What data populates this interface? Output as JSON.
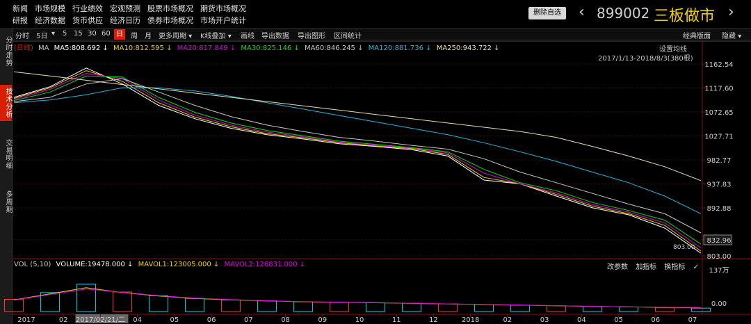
{
  "menu": {
    "row1": [
      "新闻",
      "市场规模",
      "行业绩效",
      "宏观预测",
      "股票市场概况",
      "期货市场概况"
    ],
    "row2": [
      "研报",
      "经济数据",
      "货币供应",
      "经济日历",
      "债券市场概况",
      "市场开户统计"
    ]
  },
  "header": {
    "remove_fav": "删除自选",
    "code": "899002",
    "name": "三板做市",
    "name_color": "#f0d000"
  },
  "toolbar": {
    "items": [
      "分时",
      "5日",
      "▾",
      "5",
      "15",
      "30",
      "60",
      "日",
      "周",
      "月",
      "更多周期 ▾",
      "K线叠加 ▾",
      "画线",
      "导出数据",
      "导出图形",
      "区间统计"
    ],
    "active": "日",
    "right": [
      "经典版面",
      "隐藏 ▾"
    ]
  },
  "side_tabs": [
    "分时走势",
    "技术分析",
    "交易明细",
    "多周期"
  ],
  "ma_legend": {
    "prefix": "(日线)",
    "items": [
      {
        "label": "MA",
        "color": "#c8c8c8"
      },
      {
        "label": "MA5:808.692 ↓",
        "color": "#ffffff"
      },
      {
        "label": "MA10:812.595 ↓",
        "color": "#f0d000"
      },
      {
        "label": "MA20:817.849 ↓",
        "color": "#e000e0"
      },
      {
        "label": "MA30:825.146 ↓",
        "color": "#00e000"
      },
      {
        "label": "MA60:846.245 ↓",
        "color": "#c8c8c8"
      },
      {
        "label": "MA120:881.736 ↓",
        "color": "#1fb6e0"
      },
      {
        "label": "MA250:943.722 ↓",
        "color": "#e8e0a8"
      }
    ],
    "settings": "设置均线",
    "date_range": "2017/1/13-2018/8/3(380根)"
  },
  "price_axis": {
    "ticks": [
      "1162.54",
      "1117.60",
      "1072.65",
      "1027.71",
      "982.77",
      "937.83",
      "892.88",
      "832.96",
      "803.00"
    ],
    "current": "832.96",
    "low_label": "803.00",
    "high_label": "1162.54"
  },
  "vol_legend": {
    "items": [
      {
        "label": "VOL (5,10)",
        "color": "#c8c8c8"
      },
      {
        "label": "VOLUME:19478.000 ↓",
        "color": "#ffffff"
      },
      {
        "label": "MAVOL1:123005.000 ↓",
        "color": "#f0d000"
      },
      {
        "label": "MAVOL2:126831.000 ↓",
        "color": "#e000e0"
      }
    ],
    "actions": [
      "改参数",
      "加指标",
      "换指标",
      "✓"
    ]
  },
  "vol_axis": {
    "ticks": [
      "137万",
      "0.00"
    ]
  },
  "time_axis": {
    "labels": [
      "2017",
      "02",
      "2017/02/21/二",
      "04",
      "05",
      "06",
      "07",
      "08",
      "09",
      "10",
      "11",
      "12",
      "2018",
      "02",
      "03",
      "04",
      "05",
      "06",
      "07"
    ]
  },
  "chart_data": {
    "type": "line",
    "title": "",
    "ylim": [
      803.0,
      1162.54
    ],
    "x": [
      "2017/01",
      "2017/02",
      "2017/03",
      "2017/04",
      "2017/05",
      "2017/06",
      "2017/07",
      "2017/08",
      "2017/09",
      "2017/10",
      "2017/11",
      "2017/12",
      "2018/01",
      "2018/02",
      "2018/03",
      "2018/04",
      "2018/05",
      "2018/06",
      "2018/07",
      "2018/08"
    ],
    "series": [
      {
        "name": "MA5",
        "color": "#ffffff",
        "values": [
          1100,
          1120,
          1155,
          1125,
          1085,
          1060,
          1042,
          1030,
          1022,
          1013,
          1008,
          1002,
          990,
          945,
          938,
          915,
          893,
          880,
          855,
          808
        ]
      },
      {
        "name": "MA10",
        "color": "#f0d000",
        "values": [
          1098,
          1118,
          1150,
          1130,
          1090,
          1063,
          1045,
          1032,
          1024,
          1015,
          1009,
          1004,
          993,
          950,
          938,
          918,
          896,
          882,
          860,
          812
        ]
      },
      {
        "name": "MA20",
        "color": "#e000e0",
        "values": [
          1096,
          1115,
          1145,
          1135,
          1095,
          1067,
          1048,
          1035,
          1026,
          1016,
          1010,
          1005,
          996,
          958,
          938,
          921,
          899,
          885,
          865,
          818
        ]
      },
      {
        "name": "MA30",
        "color": "#00e000",
        "values": [
          1094,
          1110,
          1140,
          1138,
          1100,
          1072,
          1052,
          1038,
          1028,
          1018,
          1012,
          1006,
          998,
          965,
          940,
          925,
          903,
          888,
          870,
          825
        ]
      },
      {
        "name": "MA60",
        "color": "#c8c8c8",
        "values": [
          1092,
          1100,
          1125,
          1135,
          1110,
          1085,
          1064,
          1048,
          1036,
          1025,
          1018,
          1010,
          1003,
          985,
          960,
          940,
          920,
          900,
          882,
          846
        ]
      },
      {
        "name": "MA120",
        "color": "#1fb6e0",
        "values": [
          1090,
          1095,
          1105,
          1118,
          1118,
          1112,
          1102,
          1090,
          1078,
          1066,
          1054,
          1042,
          1030,
          1015,
          998,
          980,
          960,
          940,
          915,
          882
        ]
      },
      {
        "name": "MA250",
        "color": "#e8e0a8",
        "values": [
          1148,
          1140,
          1132,
          1124,
          1116,
          1108,
          1100,
          1092,
          1084,
          1076,
          1068,
          1060,
          1052,
          1044,
          1036,
          1025,
          1008,
          990,
          970,
          944
        ]
      }
    ],
    "volume": {
      "ylim": [
        0,
        1370000
      ],
      "values": [
        400000,
        620000,
        900000,
        640000,
        520000,
        430000,
        380000,
        350000,
        320000,
        300000,
        290000,
        270000,
        250000,
        230000,
        210000,
        190000,
        170000,
        150000,
        130000,
        110000
      ],
      "mavol1": [
        380000,
        580000,
        780000,
        620000,
        510000,
        430000,
        380000,
        350000,
        320000,
        300000,
        285000,
        268000,
        248000,
        228000,
        208000,
        188000,
        168000,
        150000,
        135000,
        123005
      ],
      "mavol2": [
        370000,
        560000,
        740000,
        630000,
        520000,
        440000,
        390000,
        355000,
        325000,
        305000,
        290000,
        272000,
        252000,
        232000,
        212000,
        192000,
        172000,
        154000,
        139000,
        126831
      ]
    }
  }
}
